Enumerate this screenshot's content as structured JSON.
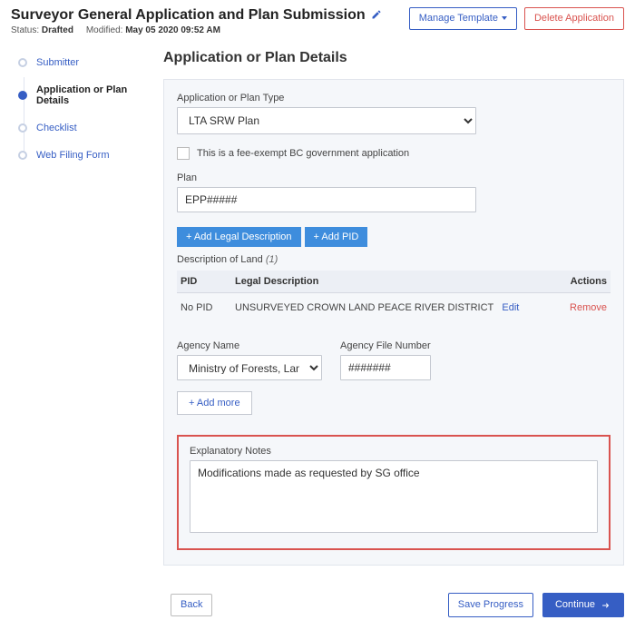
{
  "header": {
    "title": "Surveyor General Application and Plan Submission",
    "status_label": "Status:",
    "status_value": "Drafted",
    "modified_label": "Modified:",
    "modified_value": "May 05 2020 09:52 AM",
    "manage_template": "Manage Template",
    "delete_application": "Delete Application"
  },
  "sidebar": {
    "items": [
      {
        "label": "Submitter"
      },
      {
        "label": "Application or Plan Details"
      },
      {
        "label": "Checklist"
      },
      {
        "label": "Web Filing Form"
      }
    ]
  },
  "main": {
    "heading": "Application or Plan Details",
    "type_label": "Application or Plan Type",
    "type_value": "LTA SRW Plan",
    "fee_exempt": "This is a fee-exempt BC government application",
    "plan_label": "Plan",
    "plan_value": "EPP#####",
    "add_legal": "+ Add Legal Description",
    "add_pid": "+ Add PID",
    "desc_land_label": "Description of Land",
    "desc_land_count": "(1)",
    "table": {
      "cols": {
        "pid": "PID",
        "legal": "Legal Description",
        "actions": "Actions"
      },
      "rows": [
        {
          "pid": "No PID",
          "legal": "UNSURVEYED CROWN LAND PEACE RIVER DISTRICT",
          "edit": "Edit",
          "remove": "Remove"
        }
      ]
    },
    "agency_name_label": "Agency Name",
    "agency_name_value": "Ministry of Forests, Lands, Natural Resource Operations",
    "agency_file_label": "Agency File Number",
    "agency_file_value": "#######",
    "add_more": "+ Add more",
    "notes_label": "Explanatory Notes",
    "notes_value": "Modifications made as requested by SG office"
  },
  "footer": {
    "back": "Back",
    "save": "Save Progress",
    "continue": "Continue"
  }
}
